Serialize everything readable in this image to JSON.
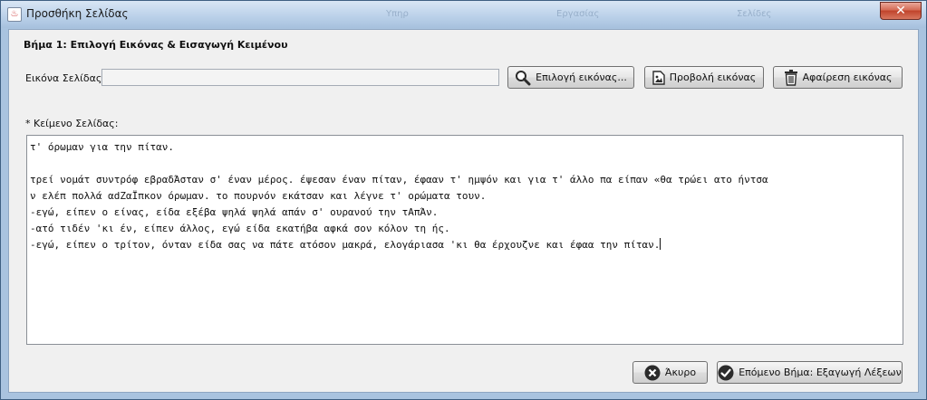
{
  "window": {
    "title": "Προσθήκη Σελίδας",
    "close_symbol": "✕",
    "ghost_items": [
      "Υπηρ",
      "Εργασίας",
      "Σελίδες"
    ]
  },
  "step": {
    "title": "Βήμα 1: Επιλογή Εικόνας & Εισαγωγή Κειμένου"
  },
  "image_row": {
    "label": "Εικόνα Σελίδας:",
    "path_value": "",
    "buttons": {
      "choose": {
        "label": "Επιλογή εικόνας...",
        "icon": "magnifier-icon"
      },
      "preview": {
        "label": "Προβολή εικόνας",
        "icon": "picture-file-icon"
      },
      "remove": {
        "label": "Αφαίρεση εικόνας",
        "icon": "trash-icon"
      }
    }
  },
  "text_section": {
    "label": "* Κείμενο Σελίδας:",
    "lines": [
      "τ' όρωμαν για την πίταν.",
      "",
      "τρεί νομάτ συντρόφ εβραδΆσταν σ' έναν μέρος. έψεσαν έναν πίταν, έφααν τ' ημψόν και για τ' άλλο πα είπαν «θα τρώει ατο ήντσα",
      "ν ελέπ πολλά αdΖαΪπκον όρωμαν. το πουρνόν εκάτσαν και λέγνε τ' ορώματα τουν.",
      "-εγώ, είπεν ο είνας, είδα εξέβα ψηλά ψηλά απάν σ' ουρανού την τΑπΆν.",
      "-ατό τιδέν 'κι έν, είπεν άλλος, εγώ είδα εκατήβα αφκά σον κόλον τη ής.",
      "-εγώ, είπεν ο τρίτον, όνταν είδα σας να πάτε ατόσον μακρά, ελογάριασα 'κι θα έρχουζνε και έφαα την πίταν."
    ]
  },
  "footer": {
    "cancel": {
      "label": "Άκυρο",
      "icon": "cancel-icon"
    },
    "next": {
      "label": "Επόμενο Βήμα: Εξαγωγή Λέξεων",
      "icon": "check-icon"
    }
  },
  "colors": {
    "title_bar": "#bcd2ea",
    "close_button": "#c0432b",
    "panel_background": "#f0f0f0",
    "icon_dark": "#2b2b2b"
  }
}
